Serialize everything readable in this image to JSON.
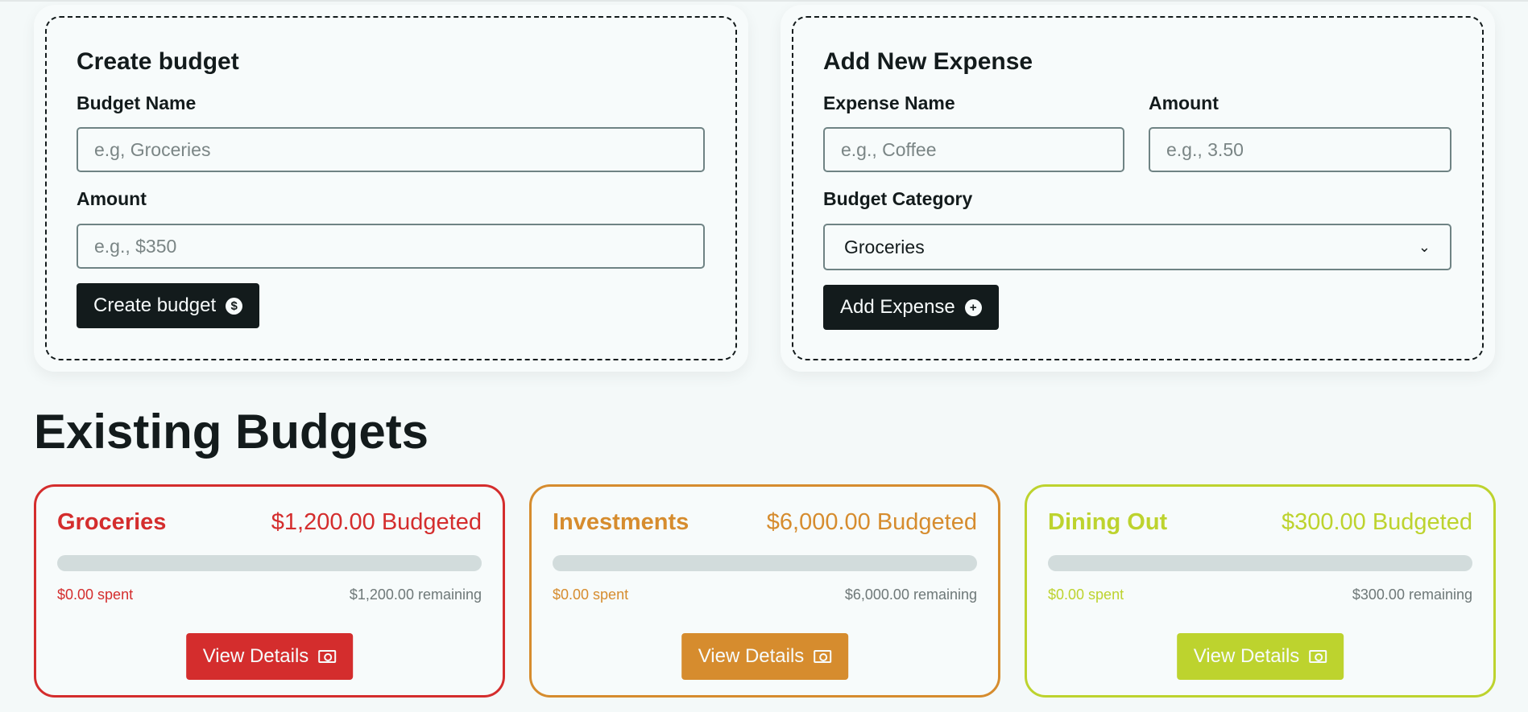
{
  "create_budget": {
    "title": "Create budget",
    "name_label": "Budget Name",
    "name_placeholder": "e.g, Groceries",
    "amount_label": "Amount",
    "amount_placeholder": "e.g., $350",
    "submit_label": "Create budget",
    "submit_icon": "dollar-circle-icon"
  },
  "add_expense": {
    "title": "Add New Expense",
    "name_label": "Expense Name",
    "name_placeholder": "e.g., Coffee",
    "amount_label": "Amount",
    "amount_placeholder": "e.g., 3.50",
    "category_label": "Budget Category",
    "category_selected": "Groceries",
    "submit_label": "Add Expense",
    "submit_icon": "plus-circle-icon"
  },
  "existing": {
    "heading": "Existing Budgets",
    "budgets": [
      {
        "name": "Groceries",
        "budgeted": "$1,200.00 Budgeted",
        "spent": "$0.00 spent",
        "remaining": "$1,200.00 remaining",
        "progress": 0,
        "color": "#d42d2d",
        "button_label": "View Details",
        "button_icon": "cash-icon"
      },
      {
        "name": "Investments",
        "budgeted": "$6,000.00 Budgeted",
        "spent": "$0.00 spent",
        "remaining": "$6,000.00 remaining",
        "progress": 0,
        "color": "#d68c2e",
        "button_label": "View Details",
        "button_icon": "cash-icon"
      },
      {
        "name": "Dining Out",
        "budgeted": "$300.00 Budgeted",
        "spent": "$0.00 spent",
        "remaining": "$300.00 remaining",
        "progress": 0,
        "color": "#bdd32e",
        "button_label": "View Details",
        "button_icon": "cash-icon"
      }
    ]
  }
}
